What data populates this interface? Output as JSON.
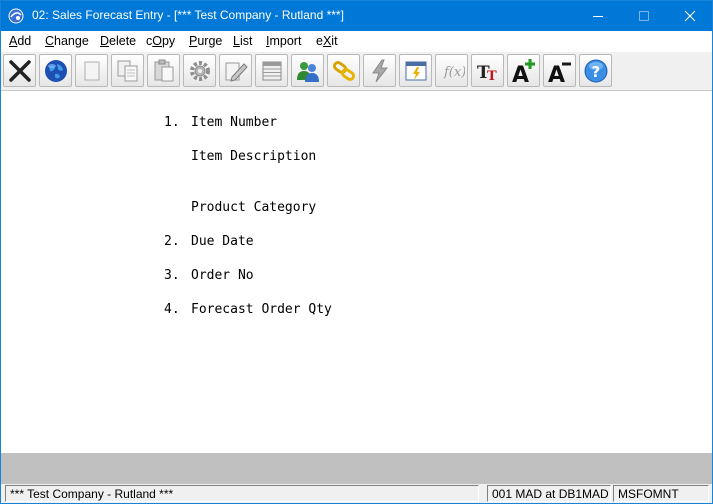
{
  "window": {
    "title": "02: Sales Forecast Entry - [*** Test Company - Rutland ***]"
  },
  "colors": {
    "titlebar": "#0078d7",
    "band": "#c0c0c0",
    "toolbar": "#f0f0f0"
  },
  "menu": [
    {
      "key": "A",
      "rest": "dd"
    },
    {
      "key": "C",
      "rest": "hange"
    },
    {
      "key": "D",
      "rest": "elete"
    },
    {
      "pre": "c",
      "key": "O",
      "rest": "py"
    },
    {
      "key": "P",
      "rest": "urge"
    },
    {
      "key": "L",
      "rest": "ist"
    },
    {
      "key": "I",
      "rest": "mport"
    },
    {
      "pre": "e",
      "key": "X",
      "rest": "it"
    }
  ],
  "toolbar": [
    "exit-icon",
    "globe-icon",
    "new-icon",
    "copy-icon",
    "paste-icon",
    "settings-icon",
    "edit-icon",
    "list-icon",
    "users-icon",
    "link-icon",
    "lightning-icon",
    "report-icon",
    "function-icon",
    "font-icon",
    "font-increase-icon",
    "font-decrease-icon",
    "help-icon"
  ],
  "form": {
    "field1_num": "1.",
    "field1_label": "Item Number",
    "field1b_label": "Item Description",
    "field1c_label": "Product Category",
    "field2_num": "2.",
    "field2_label": "Due Date",
    "field3_num": "3.",
    "field3_label": "Order No",
    "field4_num": "4.",
    "field4_label": "Forecast Order Qty"
  },
  "status": {
    "company": "*** Test Company - Rutland ***",
    "session": "001 MAD at DB1MAD",
    "program": "MSFOMNT"
  }
}
